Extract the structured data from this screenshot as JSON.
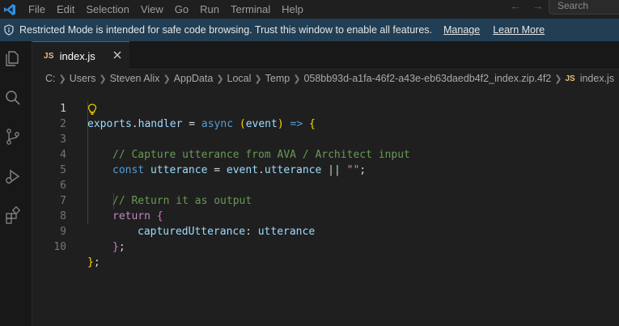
{
  "menu": {
    "items": [
      "File",
      "Edit",
      "Selection",
      "View",
      "Go",
      "Run",
      "Terminal",
      "Help"
    ],
    "search_placeholder": "Search"
  },
  "banner": {
    "message": "Restricted Mode is intended for safe code browsing. Trust this window to enable all features.",
    "manage": "Manage",
    "learn_more": "Learn More"
  },
  "tab": {
    "badge": "JS",
    "label": "index.js"
  },
  "breadcrumbs": {
    "items": [
      "C:",
      "Users",
      "Steven Alix",
      "AppData",
      "Local",
      "Temp",
      "058bb93d-a1fa-46f2-a43e-eb63daedb4f2_index.zip.4f2"
    ],
    "file_badge": "JS",
    "file": "index.js"
  },
  "editor": {
    "line_numbers": [
      "1",
      "2",
      "3",
      "4",
      "5",
      "6",
      "7",
      "8",
      "9",
      "10"
    ],
    "lines": {
      "l1": {
        "a": "exports",
        "b": ".",
        "c": "handler",
        "d": " = ",
        "e": "async",
        "f": " (",
        "g": "event",
        "h": ") ",
        "i": "=>",
        "j": " {"
      },
      "l3": {
        "a": "// Capture utterance from AVA / Architect input"
      },
      "l4": {
        "a": "const",
        "b": " utterance",
        "c": " = ",
        "d": "event",
        "e": ".",
        "f": "utterance",
        "g": " || ",
        "h": "\"\"",
        "i": ";"
      },
      "l6": {
        "a": "// Return it as output"
      },
      "l7": {
        "a": "return",
        "b": " {"
      },
      "l8": {
        "a": "capturedUtterance",
        "b": ": ",
        "c": "utterance"
      },
      "l9": {
        "a": "}",
        "b": ";"
      },
      "l10": {
        "a": "}",
        "b": ";"
      }
    }
  }
}
